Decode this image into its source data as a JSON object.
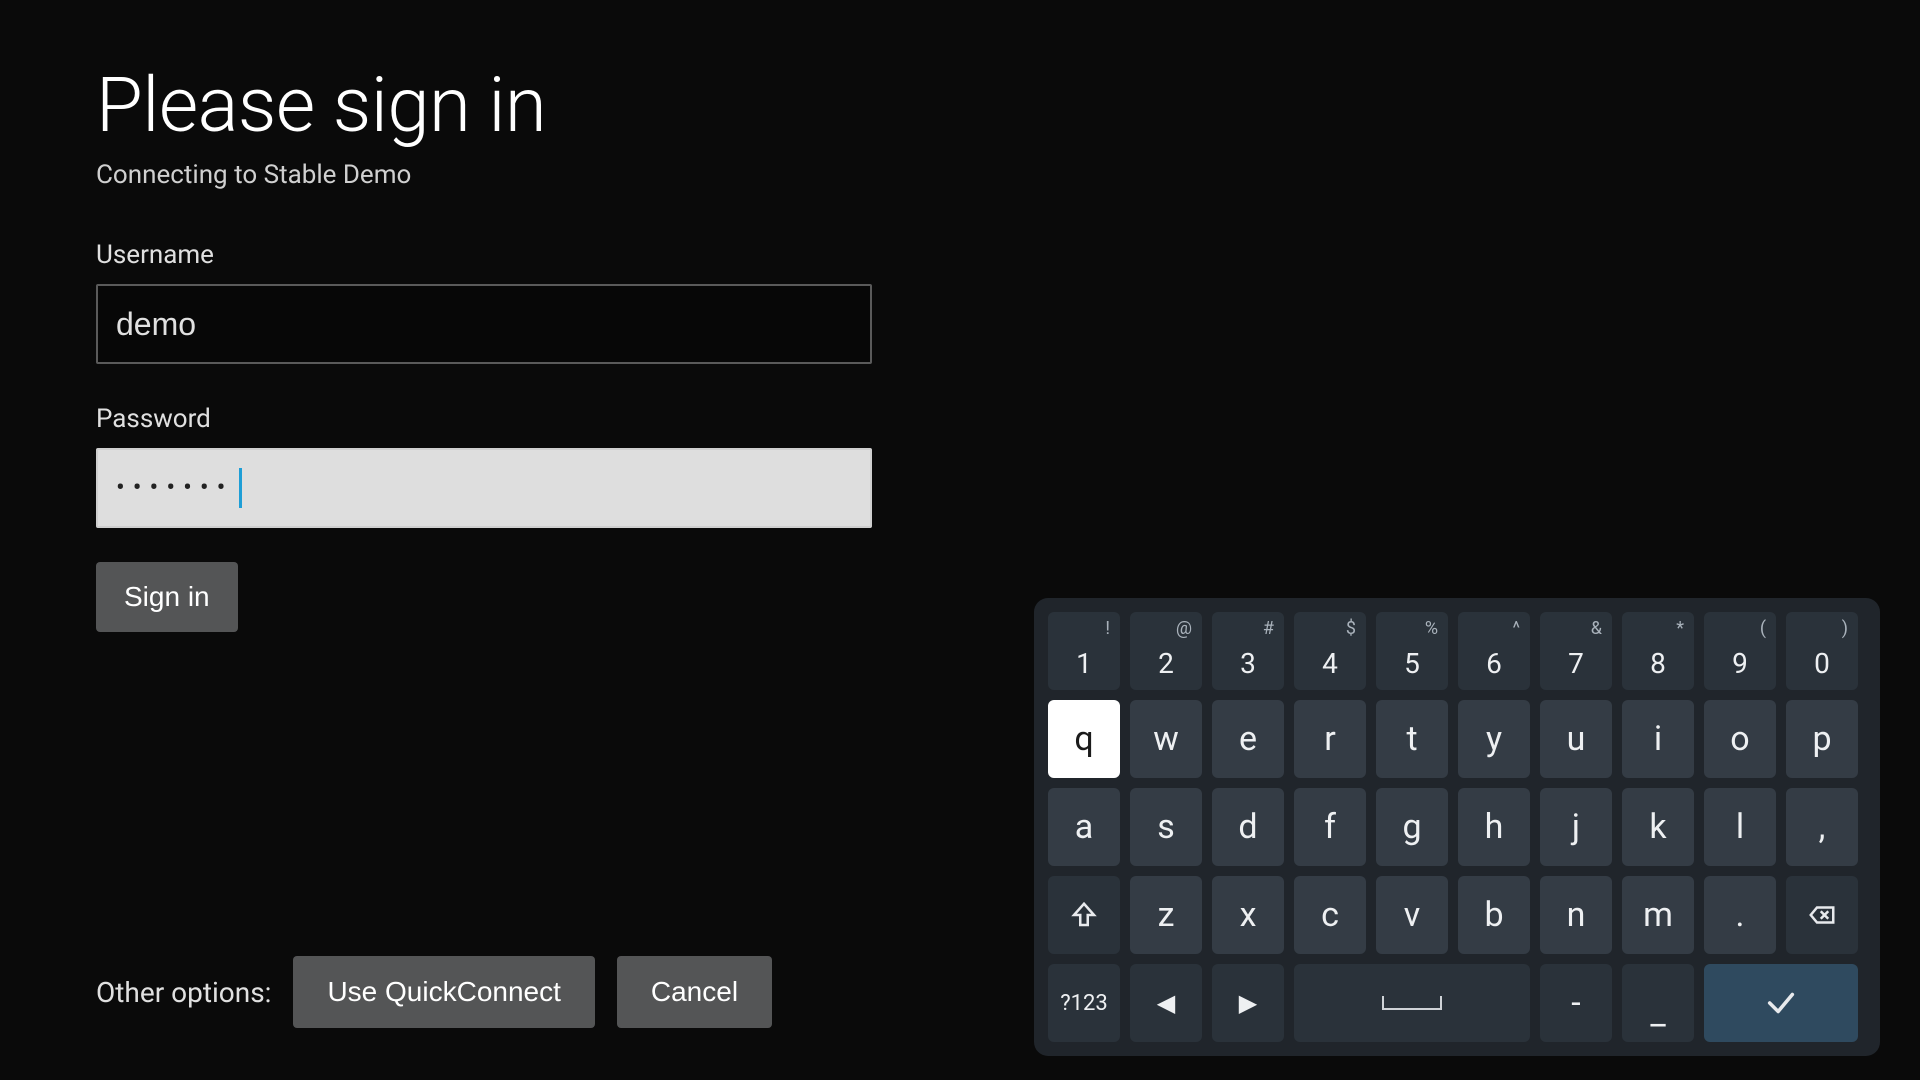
{
  "signin": {
    "title": "Please sign in",
    "subtitle": "Connecting to Stable Demo",
    "username_label": "Username",
    "username_value": "demo",
    "password_label": "Password",
    "password_masked": "•••••••",
    "signin_button": "Sign in"
  },
  "options": {
    "label": "Other options:",
    "quickconnect": "Use QuickConnect",
    "cancel": "Cancel"
  },
  "keyboard": {
    "row_num": [
      {
        "main": "1",
        "alt": "!"
      },
      {
        "main": "2",
        "alt": "@"
      },
      {
        "main": "3",
        "alt": "#"
      },
      {
        "main": "4",
        "alt": "$"
      },
      {
        "main": "5",
        "alt": "%"
      },
      {
        "main": "6",
        "alt": "^"
      },
      {
        "main": "7",
        "alt": "&"
      },
      {
        "main": "8",
        "alt": "*"
      },
      {
        "main": "9",
        "alt": "("
      },
      {
        "main": "0",
        "alt": ")"
      }
    ],
    "row_1": [
      "q",
      "w",
      "e",
      "r",
      "t",
      "y",
      "u",
      "i",
      "o",
      "p"
    ],
    "row_2": [
      "a",
      "s",
      "d",
      "f",
      "g",
      "h",
      "j",
      "k",
      "l",
      ","
    ],
    "row_3_letters": [
      "z",
      "x",
      "c",
      "v",
      "b",
      "n",
      "m",
      "."
    ],
    "mode_key": "?123",
    "dash": "-",
    "underscore": "_",
    "focused_key": "q"
  }
}
